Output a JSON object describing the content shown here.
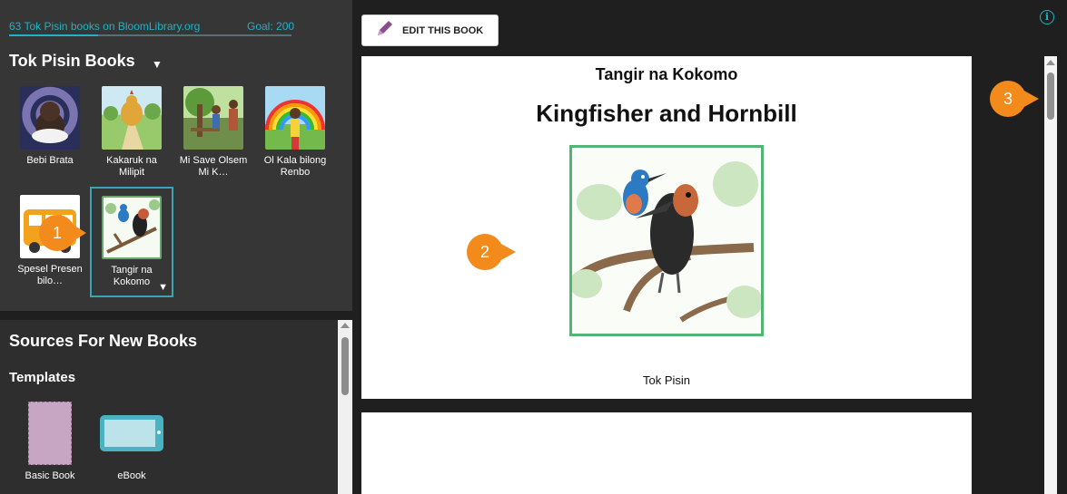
{
  "progress": {
    "count_label": "63 Tok Pisin books on BloomLibrary.org",
    "goal_label": "Goal: 200",
    "fraction": 0.315
  },
  "collection": {
    "title": "Tok Pisin Books",
    "books": [
      {
        "label": "Bebi Brata"
      },
      {
        "label": "Kakaruk na Milipit"
      },
      {
        "label": "Mi Save Olsem Mi K…"
      },
      {
        "label": "Ol Kala bilong Renbo"
      },
      {
        "label": "Spesel Presen bilo…"
      },
      {
        "label": "Tangir na Kokomo"
      }
    ]
  },
  "sources": {
    "title": "Sources For New Books",
    "templates_heading": "Templates",
    "templates": [
      {
        "label": "Basic Book"
      },
      {
        "label": "eBook"
      }
    ]
  },
  "toolbar": {
    "edit_label": "EDIT THIS BOOK"
  },
  "preview": {
    "title_local": "Tangir na Kokomo",
    "title_english": "Kingfisher and Hornbill",
    "language": "Tok Pisin"
  },
  "callouts": [
    "1",
    "2",
    "3"
  ],
  "colors": {
    "accent": "#1fb3c6",
    "callout": "#f28a1c",
    "panel": "#363636"
  }
}
